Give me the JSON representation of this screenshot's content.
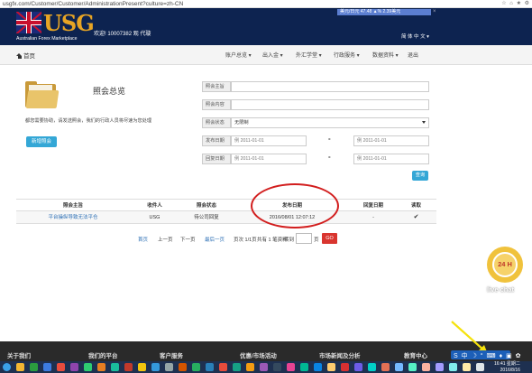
{
  "browser": {
    "url": "usgfx.com/Customer/Customer/AdministrationPresent?culture=zh-CN",
    "toolbar_icons": "☆ ⌂ ★ ⚙"
  },
  "header": {
    "brand": "USG",
    "tagline": "Australian Forex Marketplace",
    "welcome": "欢迎! 10007382 观 代璇",
    "ticker": "美元/日元 47.48 ▲% 2.39美元",
    "ticker_close": "×",
    "language": "简 体 中 文 ▾"
  },
  "nav": {
    "home": "首页",
    "items": [
      "账户总览 ▾",
      "出入金 ▾",
      "外汇学堂 ▾",
      "行政服务 ▾",
      "数据资料 ▾",
      "退出"
    ]
  },
  "left": {
    "title": "照会总览",
    "description": "都您需要协助，请发送照会，我们的行政人员将尽速为您处理",
    "new_button": "新增照会"
  },
  "form": {
    "subject_label": "照会主旨",
    "content_label": "照会内容",
    "status_label": "照会状态",
    "status_value": "无限制",
    "issue_date_label": "发布日期",
    "reply_date_label": "回复日期",
    "date_placeholder": "例 2011-01-01",
    "range_separator": "-",
    "query_button": "查询"
  },
  "table": {
    "headers": [
      "照会主旨",
      "收件人",
      "照会状态",
      "发布日期",
      "回复日期",
      "读取"
    ],
    "rows": [
      {
        "subject": "平台操纵导致无法平仓",
        "recipient": "USG",
        "status": "待公司回复",
        "issue_date": "2016/08/01 12:07:12",
        "reply_date": "-",
        "read": "✔"
      }
    ]
  },
  "pagination": {
    "first": "首页",
    "prev": "上一页",
    "next": "下一页",
    "last": "最后一页",
    "page_info": "页次 1/1页",
    "total": "共有 1 笔资料",
    "goto": "转到",
    "page_unit": "页",
    "go_button": "GO"
  },
  "livechat": {
    "badge": "24 H",
    "label": "live chat"
  },
  "footer": {
    "columns": [
      "关于我们",
      "我们的平台",
      "客户服务",
      "优惠/市场活动",
      "市场新闻及分析",
      "教育中心"
    ]
  },
  "tray": {
    "icons": "S 中 ☽ ° ⌨ ♦ ▣ ✿"
  },
  "taskbar": {
    "time": "16:41 星期二",
    "date": "2016/8/16"
  },
  "colors": {
    "header_bg": "#0d2350",
    "brand": "#e8a524",
    "button_blue": "#34a7d6",
    "go_red": "#d9352f",
    "annotation_red": "#d21e1e",
    "link": "#2c6fb5"
  }
}
